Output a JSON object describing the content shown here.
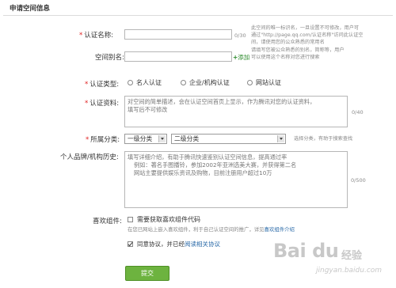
{
  "section_title": "申请空间信息",
  "cert_name": {
    "label": "认证名称:",
    "value": "",
    "counter": "0/30",
    "hint_line1": "此空间的唯一标识名，一旦设置不可修改，用户可",
    "hint_line2": "通过\"http://page.qq.com/认证名称\"访问此认证空",
    "hint_line3": "间，请使用您的公众熟悉的常用名"
  },
  "space_alias": {
    "label": "空间别名:",
    "value": "",
    "add_label": "添加",
    "hint_line1": "请填写您被公众熟悉的别名，简称等，用户",
    "hint_line2": "可以使用这个名称对您进行搜索"
  },
  "cert_type": {
    "label": "认证类型:",
    "options": [
      "名人认证",
      "企业/机构认证",
      "网站认证"
    ]
  },
  "cert_material": {
    "label": "认证资料:",
    "placeholder_line1": "对空间的简单描述，会在认证空间首页上显示，作为腾讯对您的认证资料，",
    "placeholder_line2": "填写后不可修改",
    "counter": "0/40"
  },
  "category": {
    "label": "所属分类:",
    "primary": "一级分类",
    "secondary": "二级分类",
    "hint": "选择分类，有助于搜索查找"
  },
  "brand_history": {
    "label": "个人品牌/机构历史:",
    "placeholder_line1": "填写详细介绍，有助于腾讯快速鉴别认证空间信息，提高通过率",
    "placeholder_line2": "例如：著名手图播铃，参加2002年亚洲选美大赛，并获得第二名",
    "placeholder_line3": "网站主要提供娱乐资讯及购物，目前注册用户超过10万",
    "counter": "0/500"
  },
  "widget": {
    "label": "喜欢组件:",
    "checkbox_label": "需要获取喜欢组件代码",
    "hint_prefix": "在您已网站上嵌入喜欢组件，利于自己认证空间的推广，详见",
    "hint_link": "喜欢组件介绍"
  },
  "agreement": {
    "prefix": "同意协议，并已经",
    "link": "阅读相关协议",
    "checked": true
  },
  "submit_label": "提交",
  "watermark": {
    "brand": "Bai du",
    "suffix": "经验",
    "url": "jingyan.baidu.com"
  }
}
